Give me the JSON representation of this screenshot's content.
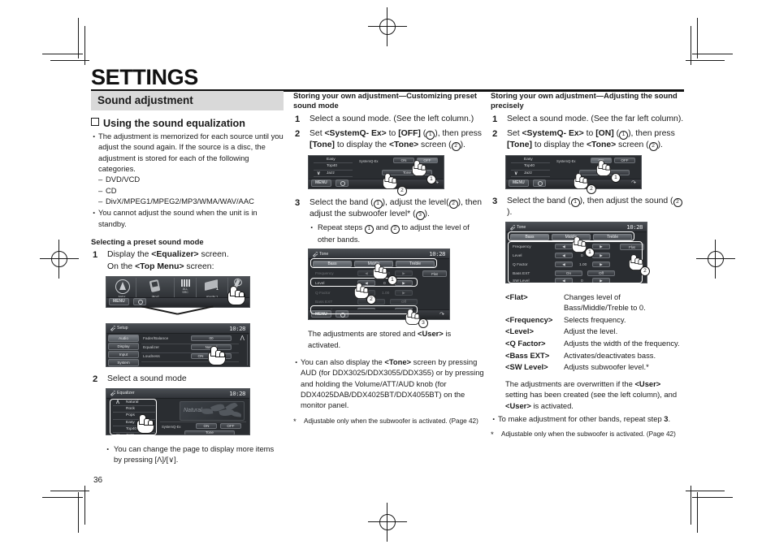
{
  "page": {
    "title": "SETTINGS",
    "number": "36"
  },
  "col1": {
    "band": "Sound adjustment",
    "checkbox_heading": "Using the sound equalization",
    "bullets": [
      "The adjustment is memorized for each source until you adjust the sound again. If the source is a disc, the adjustment is stored for each of the following categories.",
      "You cannot adjust the sound when the unit is in standby."
    ],
    "dashes": [
      "DVD/VCD",
      "CD",
      "DivX/MPEG1/MPEG2/MP3/WMA/WAV/AAC"
    ],
    "section": "Selecting a preset sound mode",
    "step1_num": "1",
    "step1_text_a": "Display the ",
    "step1_text_b": "<Equalizer>",
    "step1_text_c": " screen.",
    "step1_sub_a": "On the ",
    "step1_sub_b": "<Top Menu>",
    "step1_sub_c": " screen:",
    "step2_num": "2",
    "step2_text": "Select a sound mode",
    "step2_bullet": "You can change the page to display more items by pressing [Λ]/[∨].",
    "topmenu_shot": {
      "items": [
        "NAV",
        "iPod",
        "ALL SRC",
        "AV-IN 1",
        "SETUP"
      ],
      "menu": "MENU"
    },
    "setup_shot": {
      "title": "Setup",
      "clock": "10:28",
      "tabs": [
        "Audio",
        "Display",
        "Input",
        "System"
      ],
      "rows": [
        {
          "label": "Fader/Balance",
          "value": "00"
        },
        {
          "label": "Equalizer",
          "value": "Natural"
        },
        {
          "label": "Loudness",
          "value": "ON",
          "value2": "OFF"
        }
      ],
      "menu": "MENU"
    },
    "equalizer_shot": {
      "title": "Equalizer",
      "clock": "10:28",
      "modes": [
        "Natural",
        "Rock",
        "Pops",
        "Easy",
        "Top40",
        "Jazz"
      ],
      "art_label": "Natural",
      "sysq_label": "SystemQ-Ex",
      "on": "ON",
      "off": "OFF",
      "tone": "Tone"
    }
  },
  "col2": {
    "heading": "Storing your own adjustment—Customizing preset sound mode",
    "step1_num": "1",
    "step1_text": "Select a sound mode. (See the left column.)",
    "step2_num": "2",
    "step2_a": "Set ",
    "step2_b": "<SystemQ- Ex>",
    "step2_c": " to ",
    "step2_d": "[OFF]",
    "step2_e": " (",
    "step2_f": "), then press ",
    "step2_g": "[Tone]",
    "step2_h": " to display the ",
    "step2_i": "<Tone>",
    "step2_j": " screen (",
    "step2_k": ").",
    "step3_num": "3",
    "step3_a": "Select the band (",
    "step3_b": "), adjust the level(",
    "step3_c": "), then adjust the subwoofer level* (",
    "step3_d": ").",
    "step3_sub_a": "Repeat steps ",
    "step3_sub_b": " and ",
    "step3_sub_c": " to adjust the level of other bands.",
    "after_shot_a": "The adjustments are stored and ",
    "after_shot_b": "<User>",
    "after_shot_c": " is activated.",
    "bullet_a": "You can also display the ",
    "bullet_b": "<Tone>",
    "bullet_c": " screen by pressing AUD (for DDX3025/DDX3055/DDX355) or by pressing and holding the Volume/ATT/AUD knob (for DDX4025DAB/DDX4025BT/DDX4055BT) on the monitor panel.",
    "footnote": "Adjustable only when the subwoofer is activated. (Page 42)",
    "eq_partial_shot": {
      "modes": [
        "Easy",
        "Top40",
        "Jazz"
      ],
      "sysq_label": "SystemQ-Ex",
      "on": "ON",
      "off": "OFF",
      "tone": "Tone",
      "menu": "MENU"
    },
    "tone_shot": {
      "title": "Tone",
      "clock": "10:28",
      "tabs": [
        "Bass",
        "Middle",
        "Treble"
      ],
      "flat": "Flat",
      "rows": [
        {
          "label": "Frequency",
          "value": "100",
          "dim": true
        },
        {
          "label": "Level",
          "value": "0",
          "dim": false
        },
        {
          "label": "Q Factor",
          "value": "1.00",
          "dim": true
        },
        {
          "label": "Bass EXT",
          "value": "On",
          "value2": "Off",
          "dim": true
        },
        {
          "label": "SW Level",
          "value": "0",
          "dim": false
        }
      ],
      "menu": "MENU"
    }
  },
  "col3": {
    "heading": "Storing your own adjustment—Adjusting the sound precisely",
    "step1_num": "1",
    "step1_text": "Select a sound mode. (See the far left column).",
    "step2_num": "2",
    "step2_a": "Set ",
    "step2_b": "<SystemQ- Ex>",
    "step2_c": " to ",
    "step2_d": "[ON]",
    "step2_e": " (",
    "step2_f": "), then press ",
    "step2_g": "[Tone]",
    "step2_h": " to display the ",
    "step2_i": "<Tone>",
    "step2_j": " screen (",
    "step2_k": ").",
    "step3_num": "3",
    "step3_a": "Select the band (",
    "step3_b": "), then adjust the sound (",
    "step3_c": ").",
    "definitions": [
      {
        "key": "<Flat>",
        "value": "Changes level of Bass/Middle/Treble to 0."
      },
      {
        "key": "<Frequency>",
        "value": "Selects frequency."
      },
      {
        "key": "<Level>",
        "value": "Adjust the level."
      },
      {
        "key": "<Q Factor>",
        "value": "Adjusts the width of the frequency."
      },
      {
        "key": "<Bass EXT>",
        "value": "Activates/deactivates bass."
      },
      {
        "key": "<SW Level>",
        "value": "Adjusts subwoofer level.*"
      }
    ],
    "overwrite_a": "The adjustments are overwritten if the ",
    "overwrite_b": "<User>",
    "overwrite_c": " setting has been created (see the left column), and ",
    "overwrite_d": "<User>",
    "overwrite_e": " is activated.",
    "bullet_a": "To make adjustment for other bands, repeat step ",
    "bullet_b": "3",
    "bullet_c": ".",
    "footnote": "Adjustable only when the subwoofer is activated. (Page 42)",
    "eq_partial_shot": {
      "modes": [
        "Easy",
        "Top40",
        "Jazz"
      ],
      "sysq_label": "SystemQ-Ex",
      "on": "ON",
      "off": "OFF",
      "tone": "Tone",
      "menu": "MENU"
    },
    "tone_shot": {
      "title": "Tone",
      "clock": "10:28",
      "tabs": [
        "Bass",
        "Middle",
        "Treble"
      ],
      "flat": "Flat",
      "rows": [
        {
          "label": "Frequency",
          "value": "100"
        },
        {
          "label": "Level",
          "value": "0"
        },
        {
          "label": "Q Factor",
          "value": "1.00"
        },
        {
          "label": "Bass EXT",
          "value": "On",
          "value2": "Off"
        },
        {
          "label": "SW Level",
          "value": "0"
        }
      ]
    }
  }
}
